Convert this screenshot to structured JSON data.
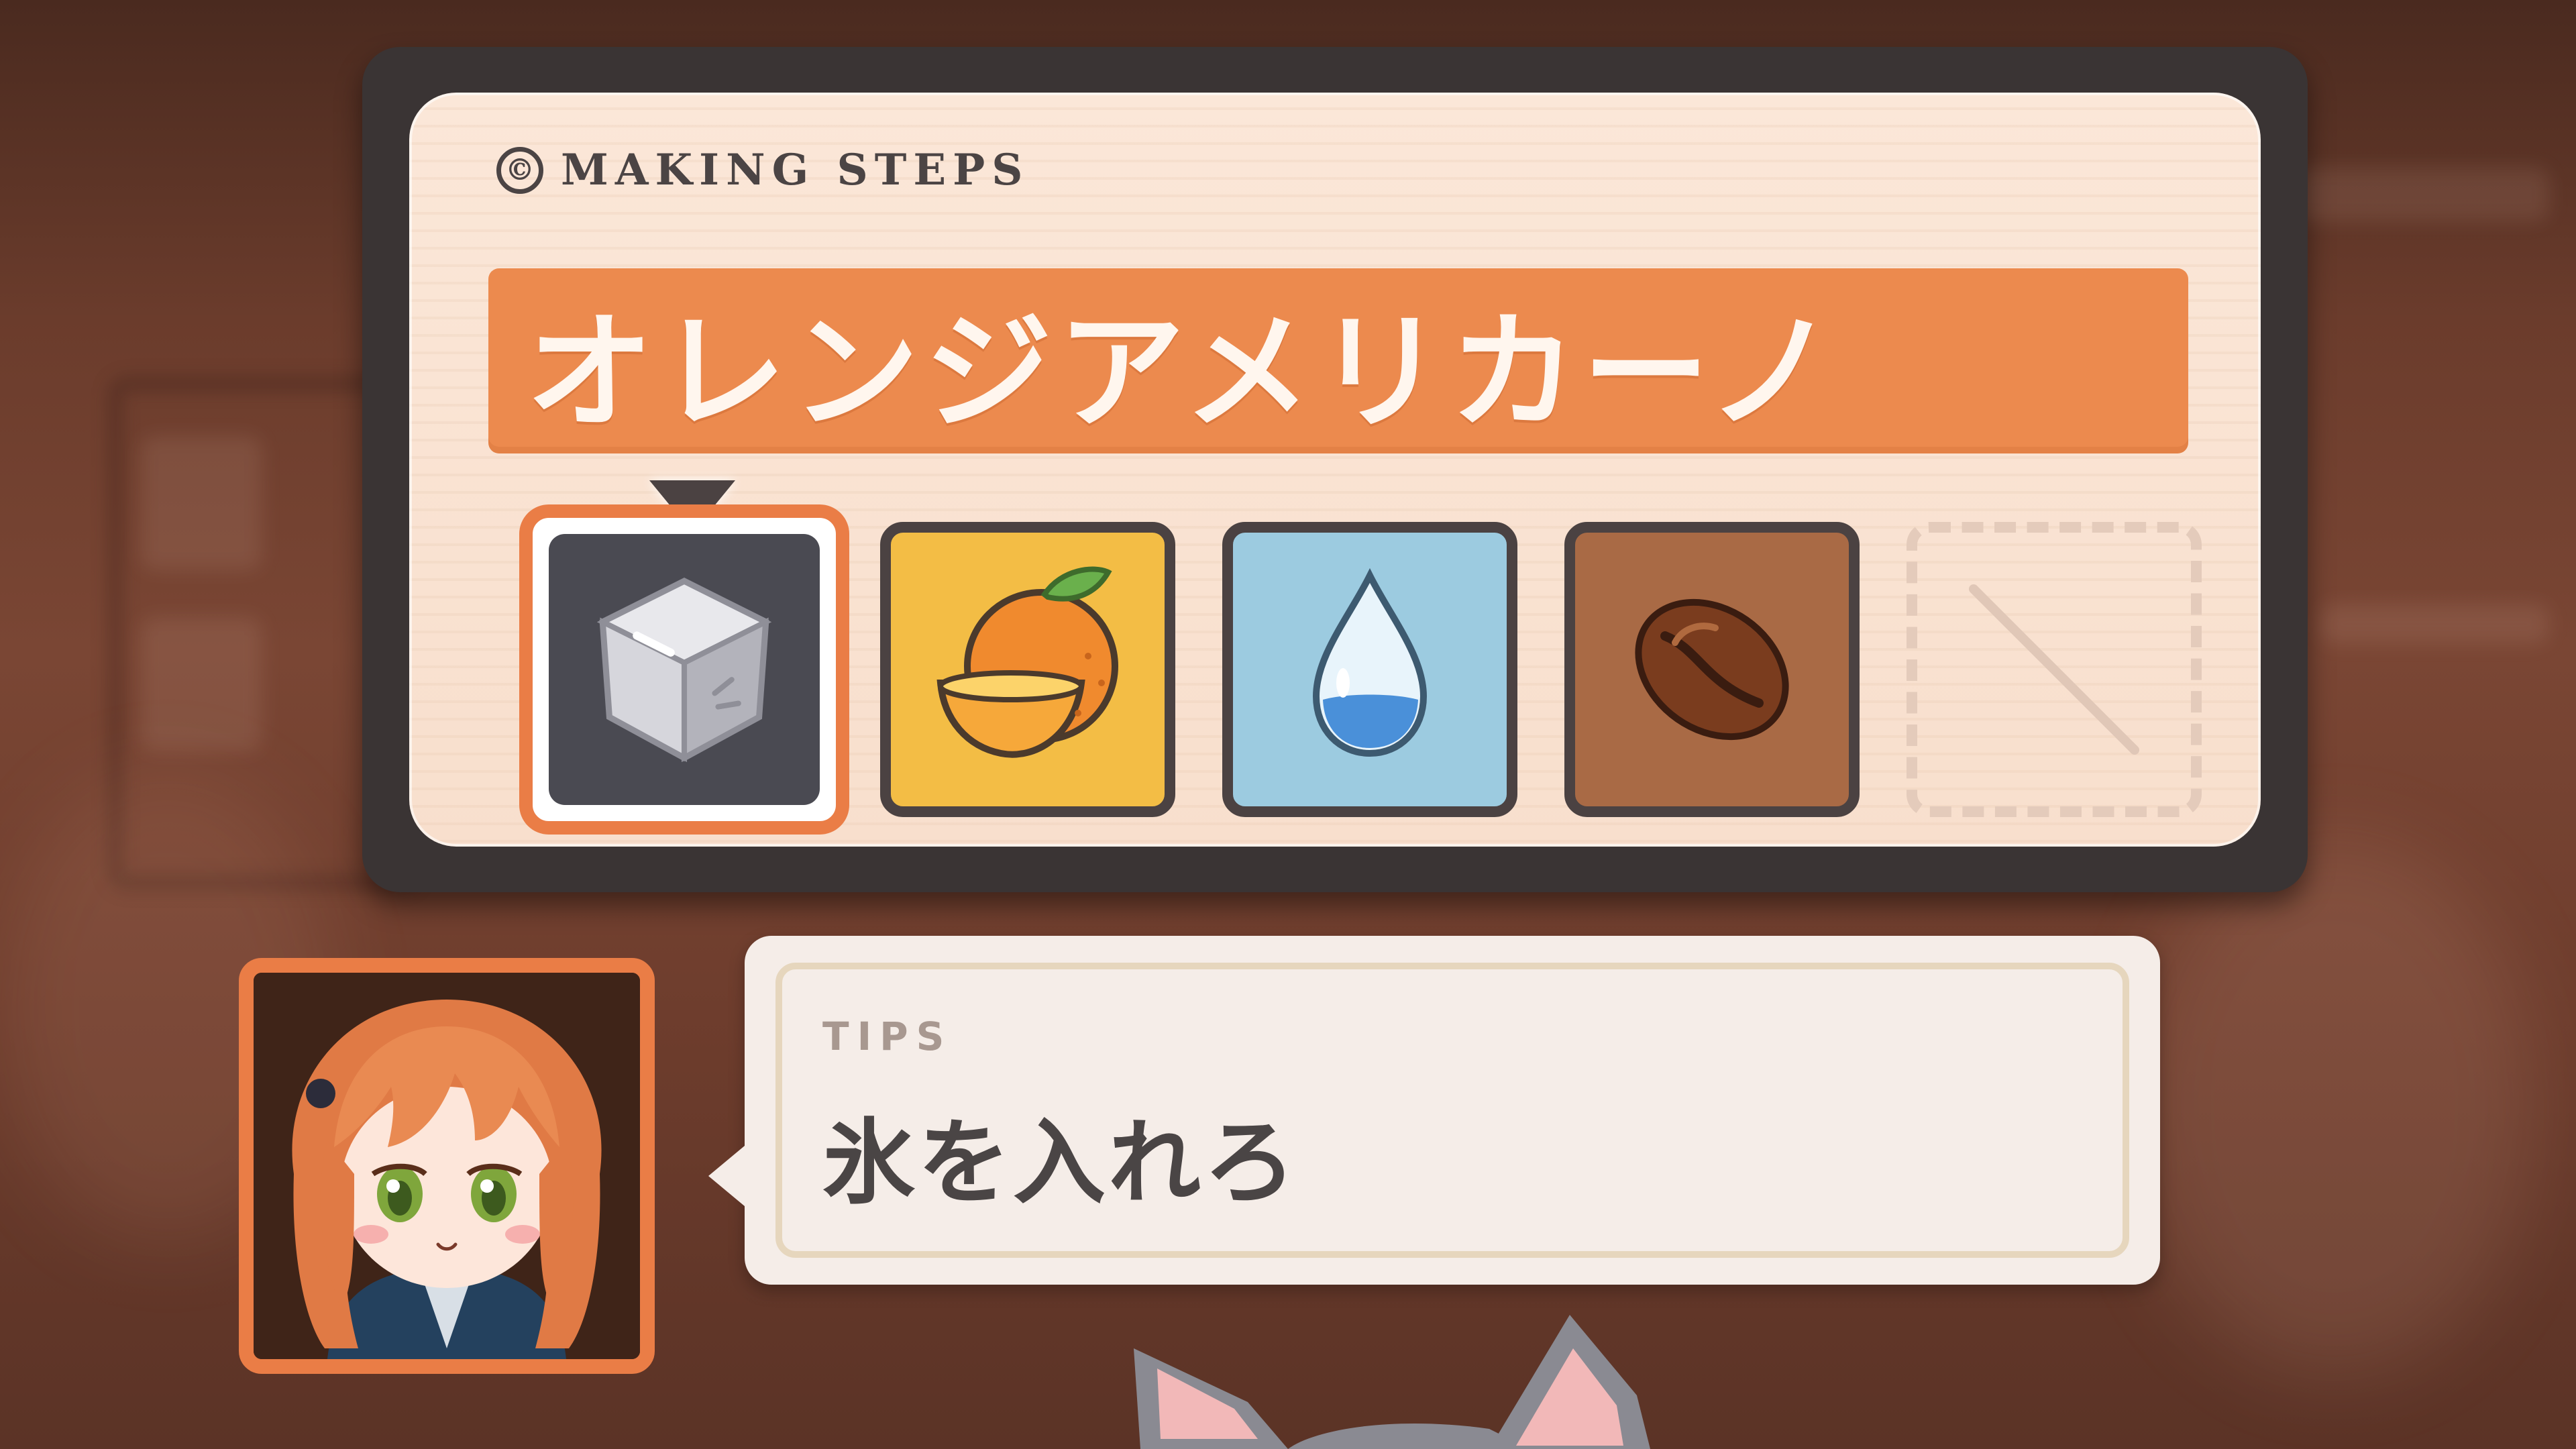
{
  "steps_panel": {
    "header_icon": "©",
    "header_label": "MAKING STEPS",
    "recipe_name": "オレンジアメリカーノ",
    "slots": [
      {
        "icon": "ice-cube-icon",
        "color": "#4a4a52",
        "selected": true
      },
      {
        "icon": "orange-icon",
        "color": "#f3bd45",
        "selected": false
      },
      {
        "icon": "water-drop-icon",
        "color": "#9ccbe0",
        "selected": false
      },
      {
        "icon": "coffee-bean-icon",
        "color": "#a96a45",
        "selected": false
      },
      {
        "icon": "empty-slot-icon",
        "color": "transparent",
        "selected": false
      }
    ]
  },
  "tips": {
    "label": "TIPS",
    "text": "氷を入れろ"
  },
  "colors": {
    "accent": "#ea7d46",
    "panel_dark": "#3a3434",
    "card": "#fbe7d8"
  }
}
